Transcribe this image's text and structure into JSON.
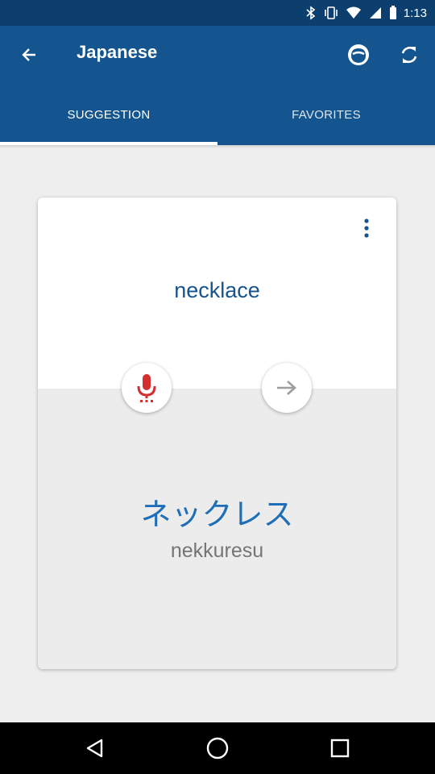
{
  "status_bar": {
    "time": "1:13"
  },
  "app_bar": {
    "title": "Japanese",
    "icons": [
      "back-arrow-icon",
      "face-icon",
      "refresh-icon"
    ]
  },
  "tabs": [
    {
      "label": "SUGGESTION",
      "selected": true
    },
    {
      "label": "FAVORITES",
      "selected": false
    }
  ],
  "card": {
    "word": "necklace",
    "translation": "ネックレス",
    "romanization": "nekkuresu"
  },
  "colors": {
    "primary": "#15558f",
    "status_bar": "#0d3f6e",
    "accent_red": "#d32f2f",
    "translation_blue": "#1e6fb8"
  }
}
